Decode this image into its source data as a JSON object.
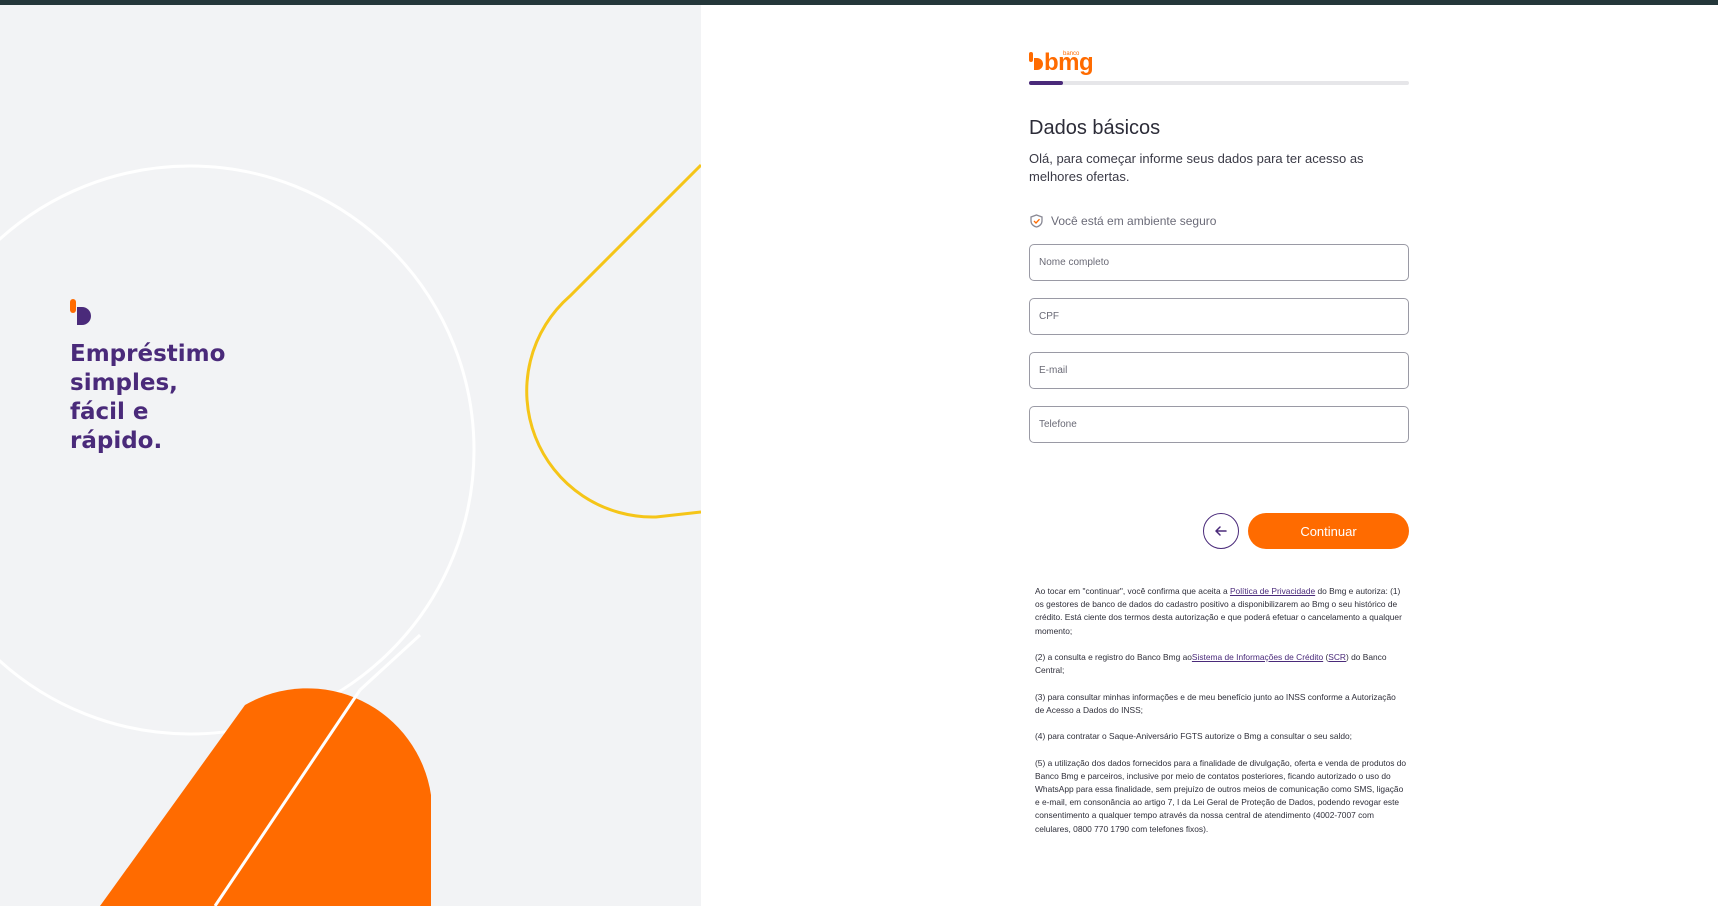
{
  "colors": {
    "brand_orange": "#ff6b00",
    "brand_purple": "#4a2a7a",
    "deco_yellow": "#f5c518",
    "panel_bg": "#f2f3f5"
  },
  "hero": {
    "logo_icon": "bmg-mark-icon",
    "title_lines": [
      "Empréstimo",
      "simples,",
      "fácil e",
      "rápido."
    ]
  },
  "brand": {
    "small_text": "banco",
    "name": "bmg"
  },
  "progress": {
    "value": 0.09
  },
  "form": {
    "title": "Dados básicos",
    "subtitle": "Olá, para começar informe seus dados para ter acesso as melhores ofertas.",
    "secure_text": "Você está em ambiente seguro",
    "fields": {
      "name": {
        "placeholder": "Nome completo",
        "value": ""
      },
      "cpf": {
        "placeholder": "CPF",
        "value": ""
      },
      "email": {
        "placeholder": "E-mail",
        "value": ""
      },
      "phone": {
        "placeholder": "Telefone",
        "value": ""
      }
    },
    "back_icon": "arrow-left-icon",
    "continue_label": "Continuar"
  },
  "legal": {
    "p1_pre": "Ao tocar em \"continuar\", você confirma que aceita a ",
    "p1_link": "Política de Privacidade",
    "p1_post": " do Bmg e autoriza: (1) os gestores de banco de dados do cadastro positivo a disponibilizarem ao Bmg o seu histórico de crédito. Está ciente dos termos desta autorização e que poderá efetuar o cancelamento a qualquer momento;",
    "p2_pre": "(2) a consulta e registro do Banco Bmg ao",
    "p2_link": "Sistema de Informações de Crédito",
    "p2_mid": " (",
    "p2_link2": "SCR",
    "p2_post": ") do Banco Central;",
    "p3": "(3) para consultar minhas informações e de meu benefício junto ao INSS conforme a Autorização de Acesso a Dados do INSS;",
    "p4": "(4) para contratar o Saque-Aniversário FGTS autorize o Bmg a consultar o seu saldo;",
    "p5": "(5) a utilização dos dados fornecidos para a finalidade de divulgação, oferta e venda de produtos do Banco Bmg e parceiros, inclusive por meio de contatos posteriores, ficando autorizado o uso do WhatsApp para essa finalidade, sem prejuízo de outros meios de comunicação como SMS, ligação e e-mail, em consonância ao artigo 7, I da Lei Geral de Proteção de Dados, podendo revogar este consentimento a qualquer tempo através da nossa central de atendimento (4002-7007 com celulares, 0800 770 1790 com telefones fixos)."
  }
}
